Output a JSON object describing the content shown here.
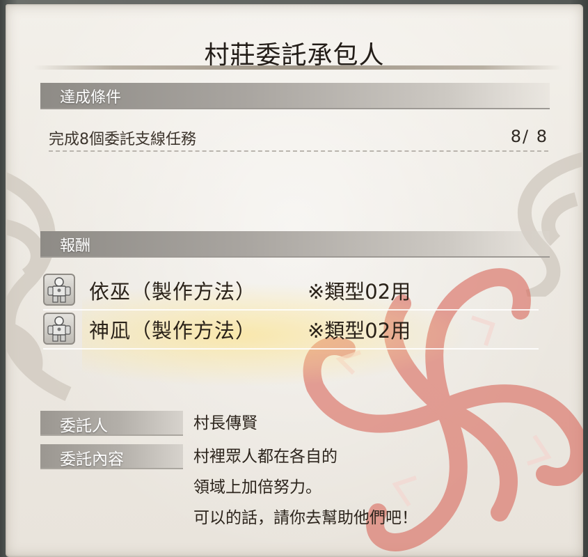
{
  "title": "村莊委託承包人",
  "conditions": {
    "header": "達成條件",
    "items": [
      {
        "text": "完成8個委託支線任務",
        "count": "8/ 8"
      }
    ]
  },
  "rewards": {
    "header": "報酬",
    "items": [
      {
        "name": "依巫（製作方法）",
        "note": "※類型02用",
        "icon": "armor-icon"
      },
      {
        "name": "神凪（製作方法）",
        "note": "※類型02用",
        "icon": "armor-icon"
      }
    ]
  },
  "client": {
    "label": "委託人",
    "value": "村長傳賢"
  },
  "details": {
    "label": "委託內容",
    "lines": [
      "村裡眾人都在各自的",
      "領域上加倍努力。",
      "可以的話，請你去幫助他們吧！"
    ]
  },
  "colors": {
    "paper": "#ece8e1",
    "header_bar": "#a9a5a0",
    "emblem_red": "#d9685c",
    "emblem_gray": "#bdb6ac",
    "reward_glow": "#ffe178"
  }
}
